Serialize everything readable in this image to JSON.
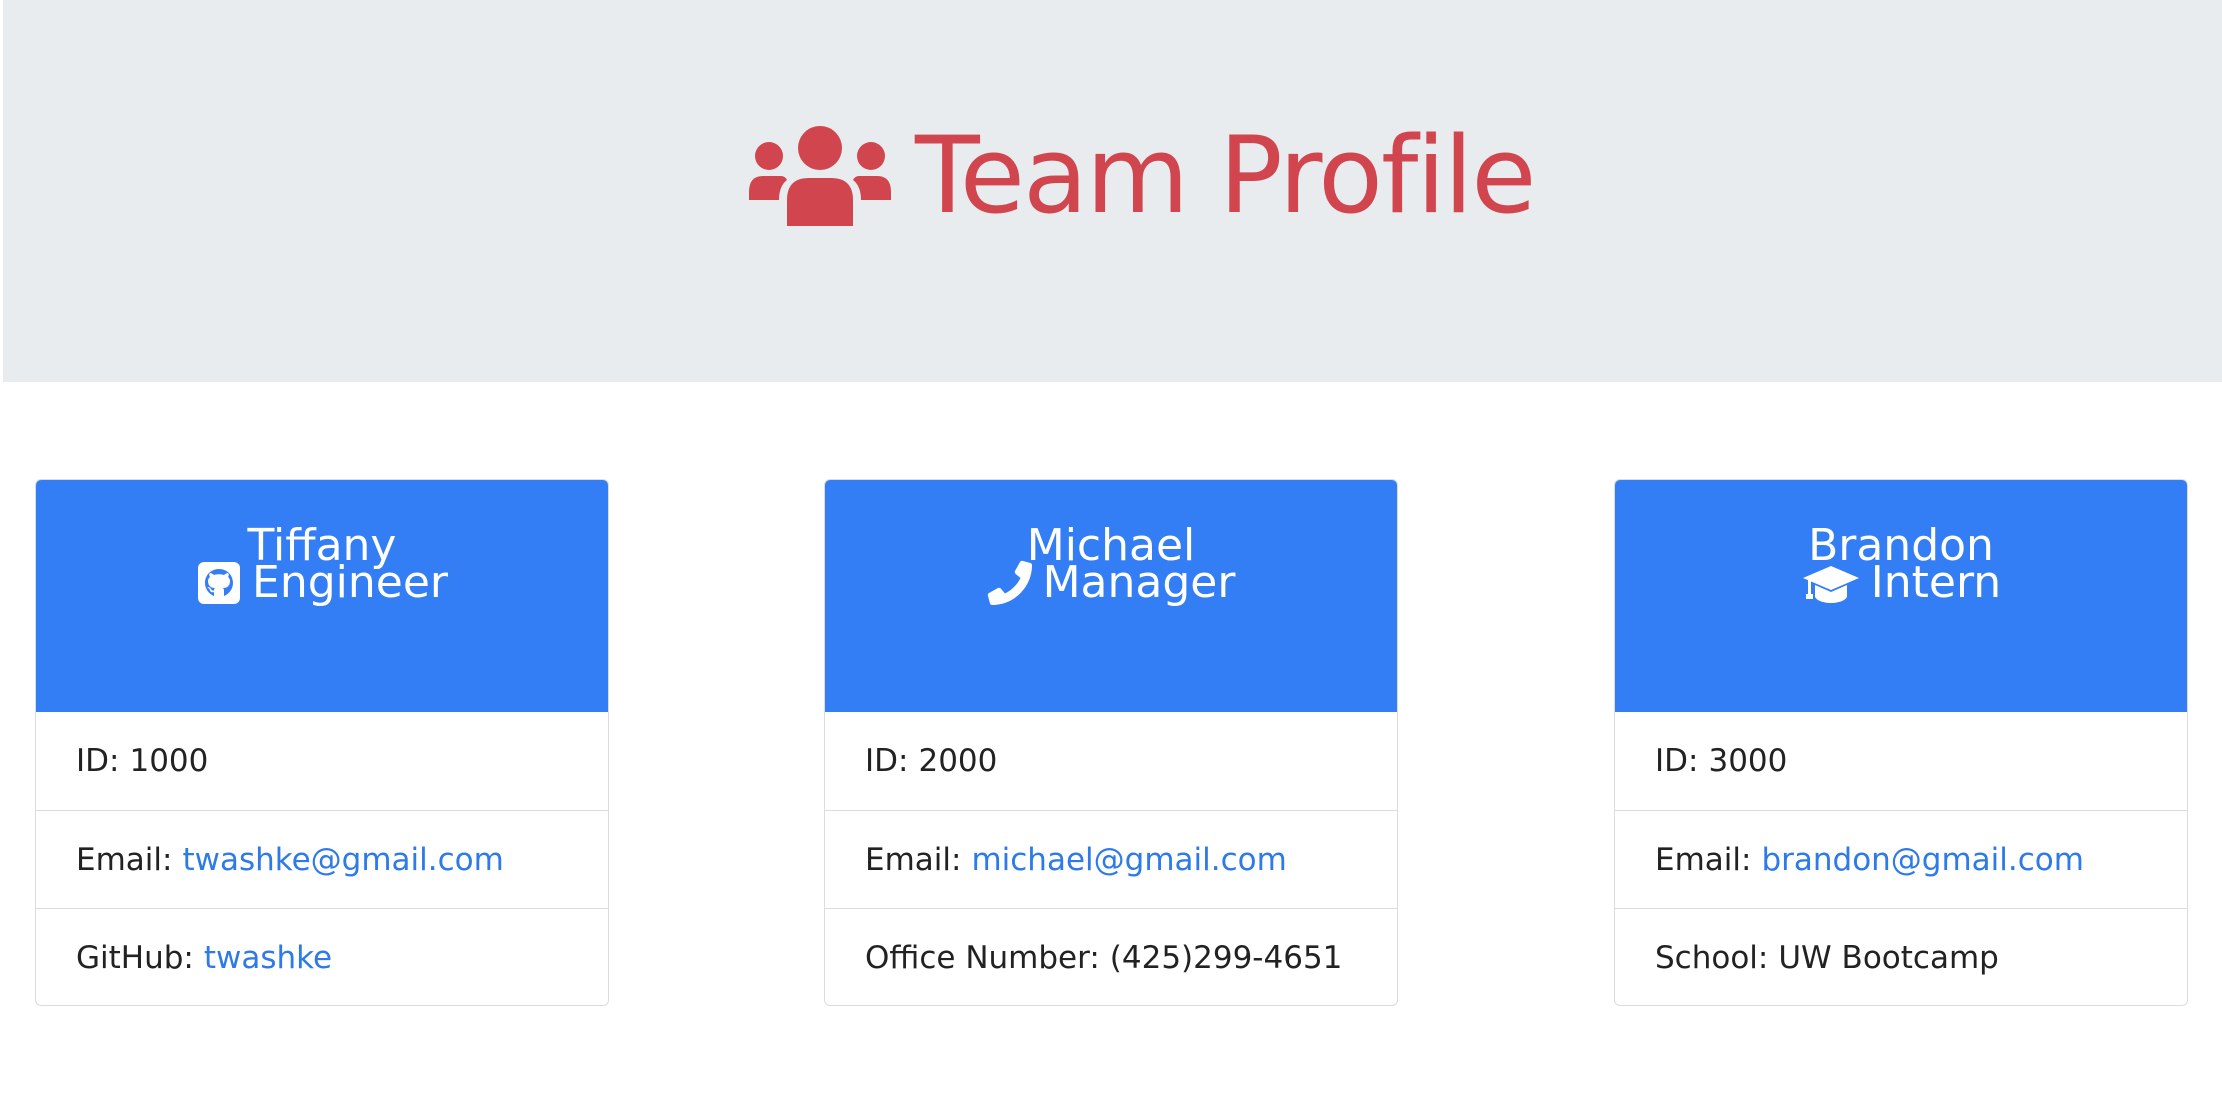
{
  "header": {
    "title": "Team Profile",
    "icon": "users-icon",
    "color": "#d1464e"
  },
  "theme": {
    "card_header_color": "#337ef5",
    "link_color": "#2d7ae8",
    "jumbotron_color": "#e9ecef"
  },
  "cards": [
    {
      "name": "Tiffany",
      "role": "Engineer",
      "role_icon": "github-icon",
      "id_label": "ID:",
      "id_value": "1000",
      "email_label": "Email:",
      "email_value": "twashke@gmail.com",
      "extra_label": "GitHub:",
      "extra_value": "twashke"
    },
    {
      "name": "Michael",
      "role": "Manager",
      "role_icon": "phone-icon",
      "id_label": "ID:",
      "id_value": "2000",
      "email_label": "Email:",
      "email_value": "michael@gmail.com",
      "extra_label": "Office Number:",
      "extra_value": "(425)299-4651"
    },
    {
      "name": "Brandon",
      "role": "Intern",
      "role_icon": "graduation-cap-icon",
      "id_label": "ID:",
      "id_value": "3000",
      "email_label": "Email:",
      "email_value": "brandon@gmail.com",
      "extra_label": "School:",
      "extra_value": "UW Bootcamp"
    }
  ]
}
